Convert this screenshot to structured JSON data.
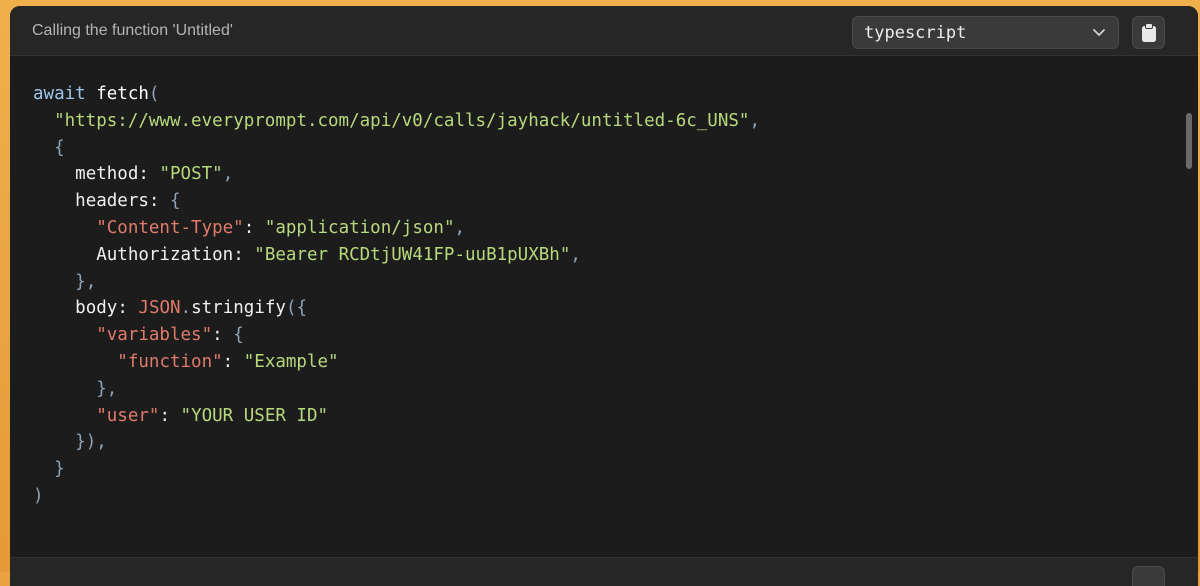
{
  "header": {
    "title": "Calling the function 'Untitled'",
    "language": "typescript",
    "copy_icon": "clipboard-icon",
    "dropdown_icon": "chevron-down-icon"
  },
  "code": {
    "language": "typescript",
    "lines": [
      "await fetch(",
      "  \"https://www.everyprompt.com/api/v0/calls/jayhack/untitled-6c_UNS\",",
      "  {",
      "    method: \"POST\",",
      "    headers: {",
      "      \"Content-Type\": \"application/json\",",
      "      Authorization: \"Bearer RCDtjUW41FP-uuB1pUXBh\",",
      "    },",
      "    body: JSON.stringify({",
      "      \"variables\": {",
      "        \"function\": \"Example\"",
      "      },",
      "      \"user\": \"YOUR USER ID\"",
      "    }),",
      "  }",
      ")"
    ],
    "tokens": {
      "await": "await",
      "fetch": "fetch",
      "url": "\"https://www.everyprompt.com/api/v0/calls/jayhack/untitled-6c_UNS\"",
      "method_key": "method",
      "method_val": "\"POST\"",
      "headers_key": "headers",
      "ct_key": "\"Content-Type\"",
      "ct_val": "\"application/json\"",
      "auth_key": "Authorization",
      "auth_val": "\"Bearer RCDtjUW41FP-uuB1pUXBh\"",
      "body_key": "body",
      "json": "JSON",
      "stringify": "stringify",
      "variables_key": "\"variables\"",
      "function_key": "\"function\"",
      "function_val": "\"Example\"",
      "user_key": "\"user\"",
      "user_val": "\"YOUR USER ID\""
    }
  },
  "colors": {
    "background_accent": "#e9a23f",
    "panel": "#1c1c1c",
    "string": "#b6d97c",
    "key": "#e07a6a",
    "keyword": "#9fc5e8"
  }
}
